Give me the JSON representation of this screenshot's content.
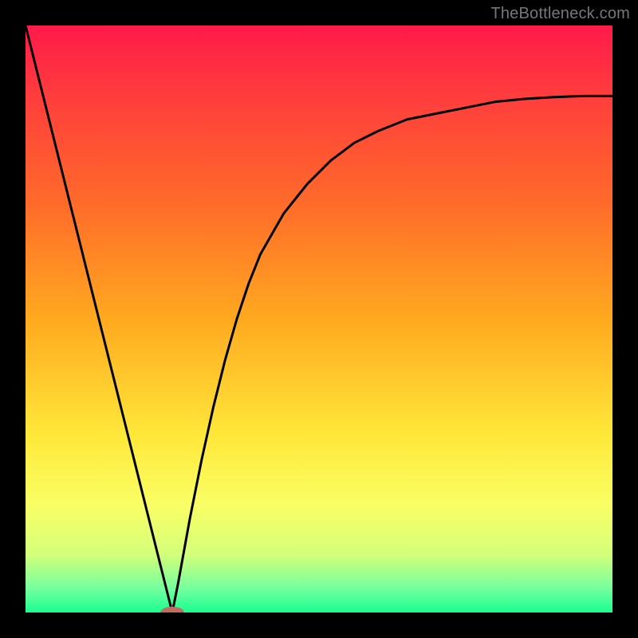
{
  "watermark": "TheBottleneck.com",
  "colors": {
    "frame_bg": "#000000",
    "curve_stroke": "#000000",
    "marker_fill": "#c46a5f",
    "gradient_stops": [
      {
        "offset": 0.0,
        "color": "#ff1a4a"
      },
      {
        "offset": 0.12,
        "color": "#ff3d3d"
      },
      {
        "offset": 0.3,
        "color": "#ff6a2a"
      },
      {
        "offset": 0.5,
        "color": "#ffa91f"
      },
      {
        "offset": 0.7,
        "color": "#ffe83a"
      },
      {
        "offset": 0.82,
        "color": "#f9ff66"
      },
      {
        "offset": 0.9,
        "color": "#d4ff7a"
      },
      {
        "offset": 0.96,
        "color": "#73ff9e"
      },
      {
        "offset": 1.0,
        "color": "#17ff90"
      }
    ]
  },
  "chart_data": {
    "type": "line",
    "title": "",
    "xlabel": "",
    "ylabel": "",
    "xlim": [
      0,
      100
    ],
    "ylim": [
      0,
      100
    ],
    "grid": false,
    "legend": false,
    "notes": "Gradient background encodes value from 100 (top, red) to 0 (bottom, green). Curve shows bottleneck-style deviation with a minimum near x≈25, y≈0.",
    "series": [
      {
        "name": "curve",
        "x": [
          0,
          2,
          4,
          6,
          8,
          10,
          12,
          14,
          16,
          18,
          20,
          22,
          24,
          25,
          26,
          28,
          30,
          32,
          34,
          36,
          38,
          40,
          44,
          48,
          52,
          56,
          60,
          65,
          70,
          75,
          80,
          85,
          90,
          95,
          100
        ],
        "y": [
          100,
          92,
          84,
          76,
          68,
          60,
          52,
          44,
          36,
          28,
          20,
          12,
          4,
          0,
          5,
          16,
          26,
          35,
          43,
          50,
          56,
          61,
          68,
          73,
          77,
          80,
          82,
          84,
          85,
          86,
          87,
          87.5,
          87.8,
          88,
          88
        ]
      }
    ],
    "marker": {
      "x": 25,
      "y": 0,
      "rx": 2.0,
      "ry": 1.0,
      "color": "#c46a5f"
    }
  }
}
